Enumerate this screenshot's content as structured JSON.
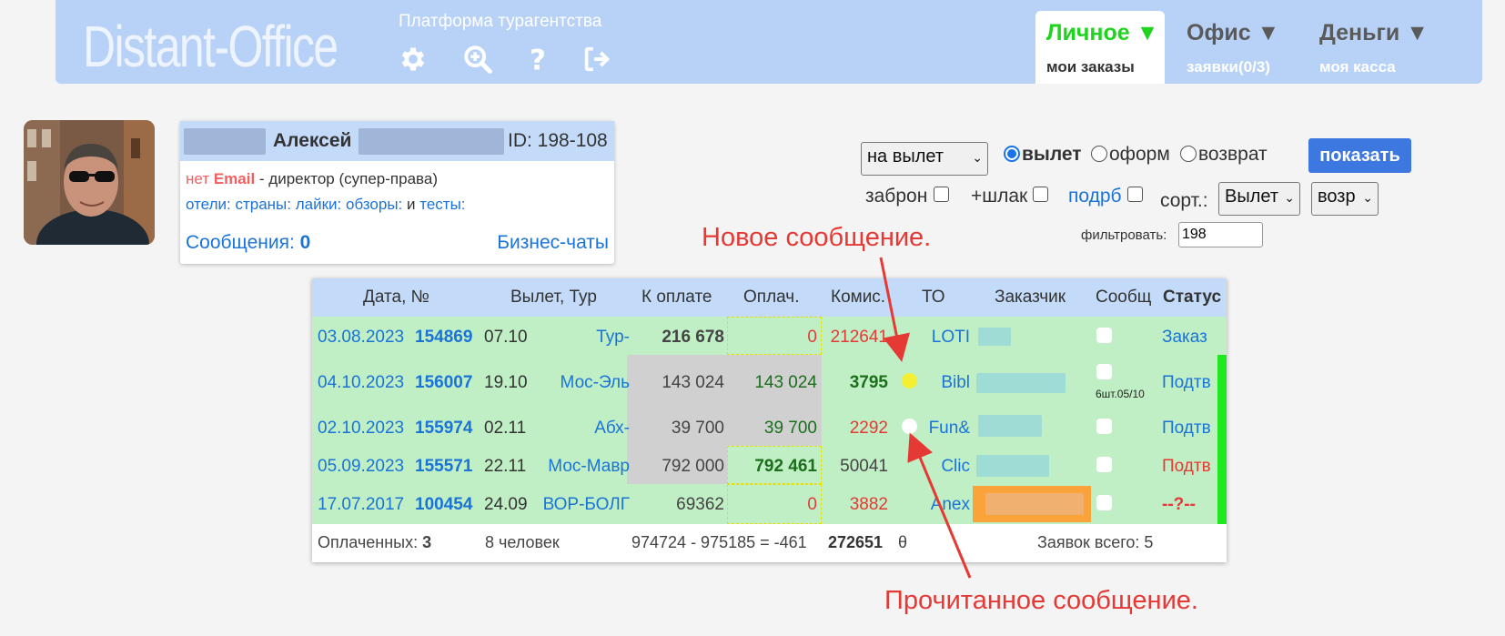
{
  "header": {
    "logo": "Distant-Office",
    "subtitle": "Платформа турагентства",
    "icons": [
      "gear-icon",
      "search-plus-icon",
      "question-icon",
      "logout-icon"
    ],
    "nav": [
      {
        "title": "Личное ▼",
        "sub": "мои заказы",
        "color": "#1fd31f",
        "active": true
      },
      {
        "title": "Офис ▼",
        "sub": "заявки(0/3)",
        "color": "#5a5a5a",
        "active": false
      },
      {
        "title": "Деньги ▼",
        "sub": "моя касса",
        "color": "#5a5a5a",
        "active": false
      }
    ]
  },
  "profile": {
    "name_part": "Алексей",
    "id": "ID: 198-108",
    "no": "нет",
    "email": "Email",
    "role": "- директор (супер-права)",
    "links": [
      "отели:",
      "страны:",
      "лайки:",
      "обзоры:",
      "и",
      "тесты:"
    ],
    "messages_label": "Сообщения:",
    "messages_count": "0",
    "chats": "Бизнес-чаты"
  },
  "filters": {
    "period_select": "на вылет",
    "radios": [
      "вылет",
      "оформ",
      "возврат"
    ],
    "show_button": "показать",
    "checks": [
      "заброн",
      "+шлак",
      "подрб"
    ],
    "sort_label": "сорт.:",
    "sort_select": "Вылет",
    "order_select": "возр",
    "filter_label": "фильтровать:",
    "filter_value": "198"
  },
  "table": {
    "headers": [
      "Дата, №",
      "Вылет, Тур",
      "К оплате",
      "Оплач.",
      "Комис.",
      "ТО",
      "Заказчик",
      "Сообщ",
      "Статус"
    ],
    "rows": [
      {
        "date": "03.08.2023",
        "num": "154869",
        "dep": "07.10",
        "tour": "Тур-",
        "topay": "216 678",
        "paid": "0",
        "comm": "212641",
        "to": "LOTI",
        "status": "Заказ",
        "msg": ""
      },
      {
        "date": "04.10.2023",
        "num": "156007",
        "dep": "19.10",
        "tour": "Мос-Эль",
        "topay": "143 024",
        "paid": "143 024",
        "comm": "3795",
        "to": "Bibl",
        "status": "Подтв",
        "msg": "6шт.05/10"
      },
      {
        "date": "02.10.2023",
        "num": "155974",
        "dep": "02.11",
        "tour": "Абх-",
        "topay": "39 700",
        "paid": "39 700",
        "comm": "2292",
        "to": "Fun&",
        "status": "Подтв",
        "msg": ""
      },
      {
        "date": "05.09.2023",
        "num": "155571",
        "dep": "22.11",
        "tour": "Мос-Мавр",
        "topay": "792 000",
        "paid": "792 461",
        "comm": "50041",
        "to": "Clic",
        "status": "Подтв",
        "msg": ""
      },
      {
        "date": "17.07.2017",
        "num": "100454",
        "dep": "24.09",
        "tour": "ВОР-БОЛГ",
        "topay": "69362",
        "paid": "0",
        "comm": "3882",
        "to": "Anex",
        "status": "--?--",
        "msg": ""
      }
    ],
    "footer": {
      "paid_label": "Оплаченных:",
      "paid_count": "3",
      "people": "8 человек",
      "balance": "974724 - 975185 = -461",
      "comm_total": "272651",
      "theta": "θ",
      "total": "Заявок всего: 5"
    }
  },
  "annotations": {
    "new_msg": "Новое сообщение.",
    "read_msg": "Прочитанное сообщение."
  }
}
